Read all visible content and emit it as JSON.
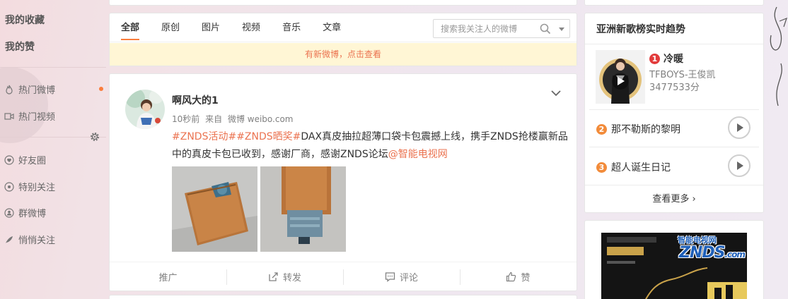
{
  "sidebar": {
    "collections": "我的收藏",
    "likes": "我的赞",
    "items": [
      {
        "label": "热门微博",
        "icon": "fire-icon"
      },
      {
        "label": "热门视频",
        "icon": "video-icon"
      },
      {
        "label": "好友圈",
        "icon": "heart-icon"
      },
      {
        "label": "特别关注",
        "icon": "eye-icon"
      },
      {
        "label": "群微博",
        "icon": "group-icon"
      },
      {
        "label": "悄悄关注",
        "icon": "feather-icon"
      }
    ]
  },
  "feed_tabs": {
    "tabs": [
      "全部",
      "原创",
      "图片",
      "视频",
      "音乐",
      "文章"
    ],
    "active": "全部",
    "search_placeholder": "搜索我关注人的微博",
    "new_notice": "有新微博，点击查看"
  },
  "post": {
    "author": "啊风大的1",
    "time": "10秒前",
    "from_prefix": "来自",
    "source": "微博 weibo.com",
    "hashtags": "#ZNDS活动##ZNDS晒奖#",
    "body": "DAX真皮抽拉超薄口袋卡包震撼上线，携手ZNDS抢楼赢新品中的真皮卡包已收到，感谢厂商，感谢ZNDS论坛",
    "mention": "@智能电视网",
    "actions": {
      "promote": "推广",
      "repost": "转发",
      "comment": "评论",
      "like": "赞"
    }
  },
  "music_chart": {
    "title": "亚洲新歌榜实时趋势",
    "songs": [
      {
        "rank": "1",
        "title": "冷暖",
        "artist": "TFBOYS-王俊凯",
        "score": "3477533分"
      },
      {
        "rank": "2",
        "title": "那不勒斯的黎明"
      },
      {
        "rank": "3",
        "title": "超人诞生日记"
      }
    ],
    "more": "查看更多 ›"
  },
  "ad": {
    "brand": "ZNDS",
    "caption": "智能电视网",
    "site": ".com"
  },
  "colors": {
    "accent": "#fa7d3c",
    "link": "#eb7350",
    "notice_bg": "#fff6d5"
  }
}
